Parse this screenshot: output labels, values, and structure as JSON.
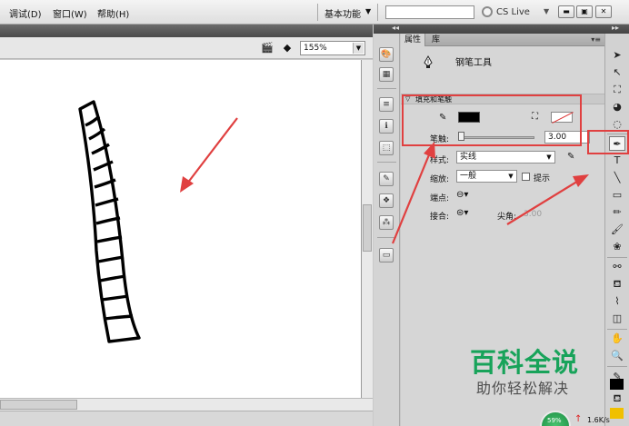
{
  "menubar": {
    "items": [
      "调试(D)",
      "窗口(W)",
      "帮助(H)"
    ],
    "workspace": "基本功能",
    "search_value": "",
    "cs_live": "CS Live"
  },
  "stage": {
    "zoom": "155%"
  },
  "panel": {
    "tabs": [
      "属性",
      "库"
    ],
    "tool_name": "钢笔工具",
    "section": "填充和笔触",
    "stroke_width_label": "笔触:",
    "stroke_width_value": "3.00",
    "style_label": "样式:",
    "style_value": "实线",
    "scale_label": "缩放:",
    "scale_value": "一般",
    "hint_label": "提示",
    "cap_label": "端点:",
    "join_label": "接合:",
    "miter_label": "尖角:",
    "miter_value": "3.00"
  },
  "watermark": {
    "title": "百科全说",
    "subtitle": "助你轻松解决"
  },
  "status": {
    "badge": "59%",
    "speed": "1.6K/s"
  },
  "colors": {
    "annotation_red": "#e04040",
    "watermark_green": "#18a35a",
    "stroke_color": "#000000"
  }
}
